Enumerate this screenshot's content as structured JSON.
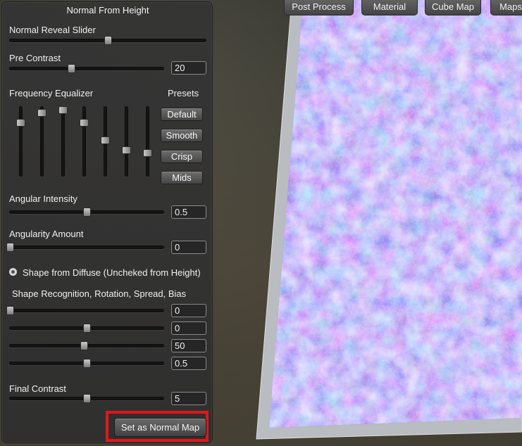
{
  "tabs": [
    "Post Process",
    "Material",
    "Cube Map",
    "Maps"
  ],
  "panel": {
    "title": "Normal From Height",
    "normal_reveal": {
      "label": "Normal Reveal Slider",
      "value": 0.5
    },
    "pre_contrast": {
      "label": "Pre Contrast",
      "value_text": "20",
      "value": 0.4
    },
    "freq_eq": {
      "label": "Frequency Equalizer",
      "bands": [
        0.22,
        0.08,
        0.04,
        0.22,
        0.48,
        0.62,
        0.66
      ]
    },
    "presets": {
      "label": "Presets",
      "buttons": [
        "Default",
        "Smooth",
        "Crisp",
        "Mids"
      ]
    },
    "angular_intensity": {
      "label": "Angular Intensity",
      "value_text": "0.5",
      "value": 0.5
    },
    "angularity_amount": {
      "label": "Angularity Amount",
      "value_text": "0",
      "value": 0.0
    },
    "shape_from_diffuse": {
      "label": "Shape from Diffuse (Uncheked from Height)",
      "checked": true
    },
    "shape_recognition": {
      "label": "Shape Recognition, Rotation, Spread, Bias",
      "rows": [
        {
          "value_text": "0",
          "value": 0.0
        },
        {
          "value_text": "0",
          "value": 0.5
        },
        {
          "value_text": "50",
          "value": 0.48
        },
        {
          "value_text": "0.5",
          "value": 0.5
        }
      ]
    },
    "final_contrast": {
      "label": "Final Contrast",
      "value_text": "5",
      "value": 0.5
    },
    "set_normal_button": "Set as Normal Map"
  },
  "colors": {
    "highlight": "#e0161c",
    "normal_map_base": "#6f6ff0"
  }
}
